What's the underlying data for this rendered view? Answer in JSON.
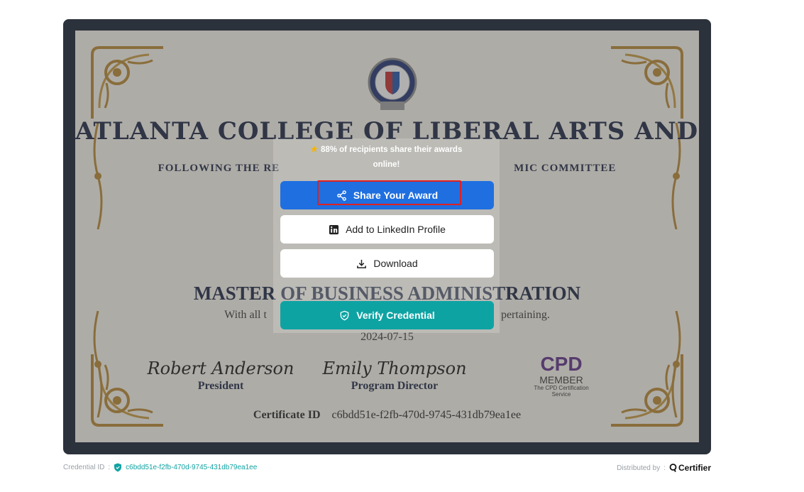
{
  "certificate": {
    "college_name": "ATLANTA COLLEGE OF LIBERAL ARTS AND SCIENCES",
    "following_text": "FOLLOWING THE RE",
    "following_text_end": "MIC COMMITTEE",
    "degree": "MASTER OF BUSINESS ADMINISTRATION",
    "with_all": "With all t",
    "with_all_end": "pertaining.",
    "date": "2024-07-15",
    "signatures": [
      {
        "script": "Robert Anderson",
        "role": "President"
      },
      {
        "script": "Emily Thompson",
        "role": "Program Director"
      }
    ],
    "cpd": {
      "big": "CPD",
      "member": "MEMBER",
      "service": "The CPD Certification Service"
    },
    "certificate_id_label": "Certificate ID",
    "certificate_id": "c6bdd51e-f2fb-470d-9745-431db79ea1ee"
  },
  "share_popup": {
    "stat_line1": "88% of recipients share their awards",
    "stat_line2": "online!",
    "share_label": "Share Your Award",
    "linkedin_label": "Add to LinkedIn Profile",
    "download_label": "Download",
    "verify_label": "Verify Credential"
  },
  "footer": {
    "credential_label": "Credential ID",
    "credential_id": "c6bdd51e-f2fb-470d-9745-431db79ea1ee",
    "distributed_by": "Distributed by",
    "brand": "Certifier"
  },
  "colors": {
    "share_button": "#1f6fe0",
    "verify_button": "#0ea3a3",
    "frame": "#0f1b2d",
    "highlight": "#e02020",
    "gold": "#b8862b"
  }
}
